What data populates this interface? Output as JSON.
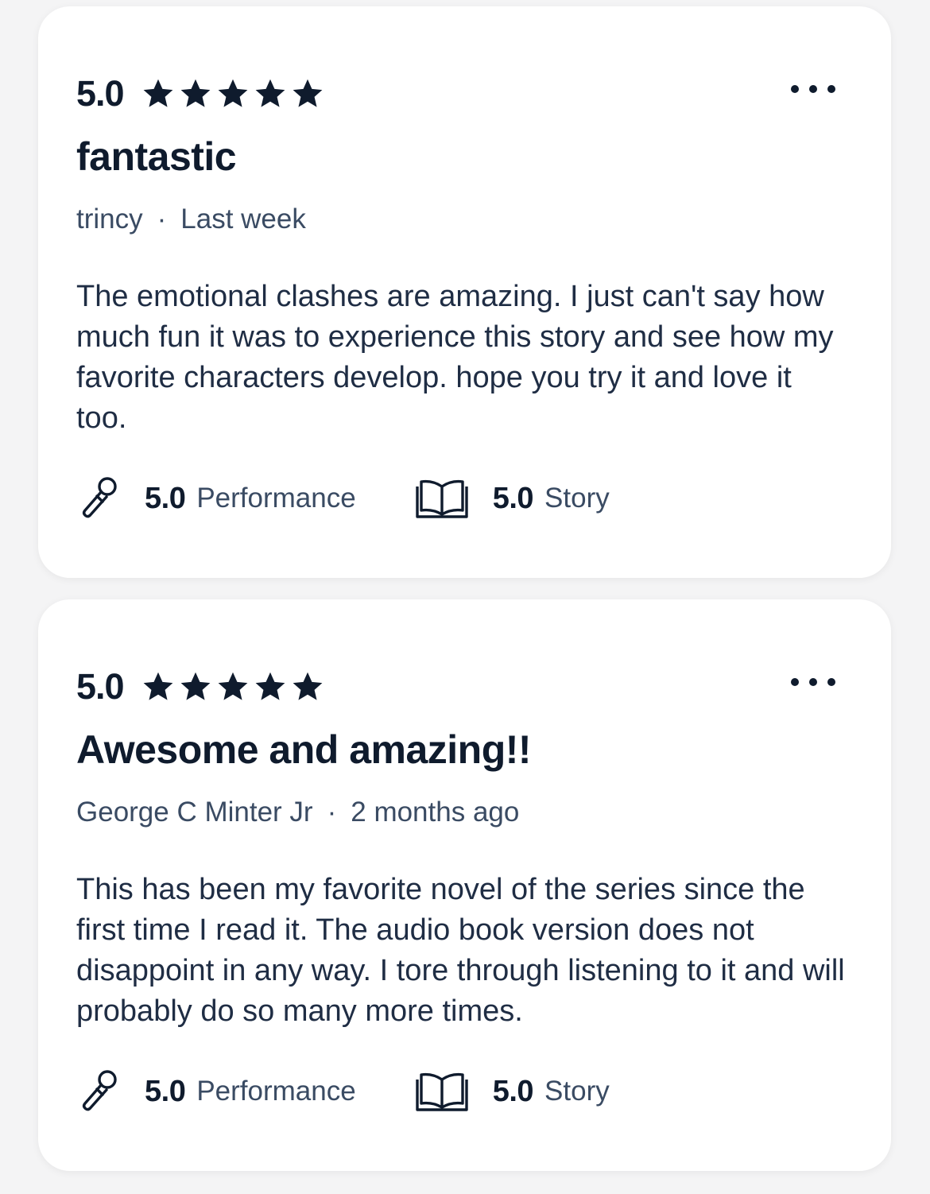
{
  "reviews": [
    {
      "rating": "5.0",
      "stars": 5,
      "title": "fantastic",
      "author": "trincy",
      "separator": "·",
      "date": "Last week",
      "body": "The emotional clashes are amazing. I just can't say how much fun it was to experience this story and see how my favorite characters develop. hope you try it and love it too.",
      "performance": {
        "value": "5.0",
        "label": "Performance",
        "icon": "microphone-icon"
      },
      "story": {
        "value": "5.0",
        "label": "Story",
        "icon": "open-book-icon"
      }
    },
    {
      "rating": "5.0",
      "stars": 5,
      "title": "Awesome and amazing!!",
      "author": "George C Minter Jr",
      "separator": "·",
      "date": "2 months ago",
      "body": "This has been my favorite novel of the series since the first time I read it. The audio book version does not disappoint in any way. I tore through listening to it and will probably do so many more times.",
      "performance": {
        "value": "5.0",
        "label": "Performance",
        "icon": "microphone-icon"
      },
      "story": {
        "value": "5.0",
        "label": "Story",
        "icon": "open-book-icon"
      }
    }
  ],
  "colors": {
    "text_primary": "#0f1b2d",
    "text_secondary": "#3a4b63",
    "card_background": "#ffffff",
    "page_background": "#f4f4f5"
  }
}
